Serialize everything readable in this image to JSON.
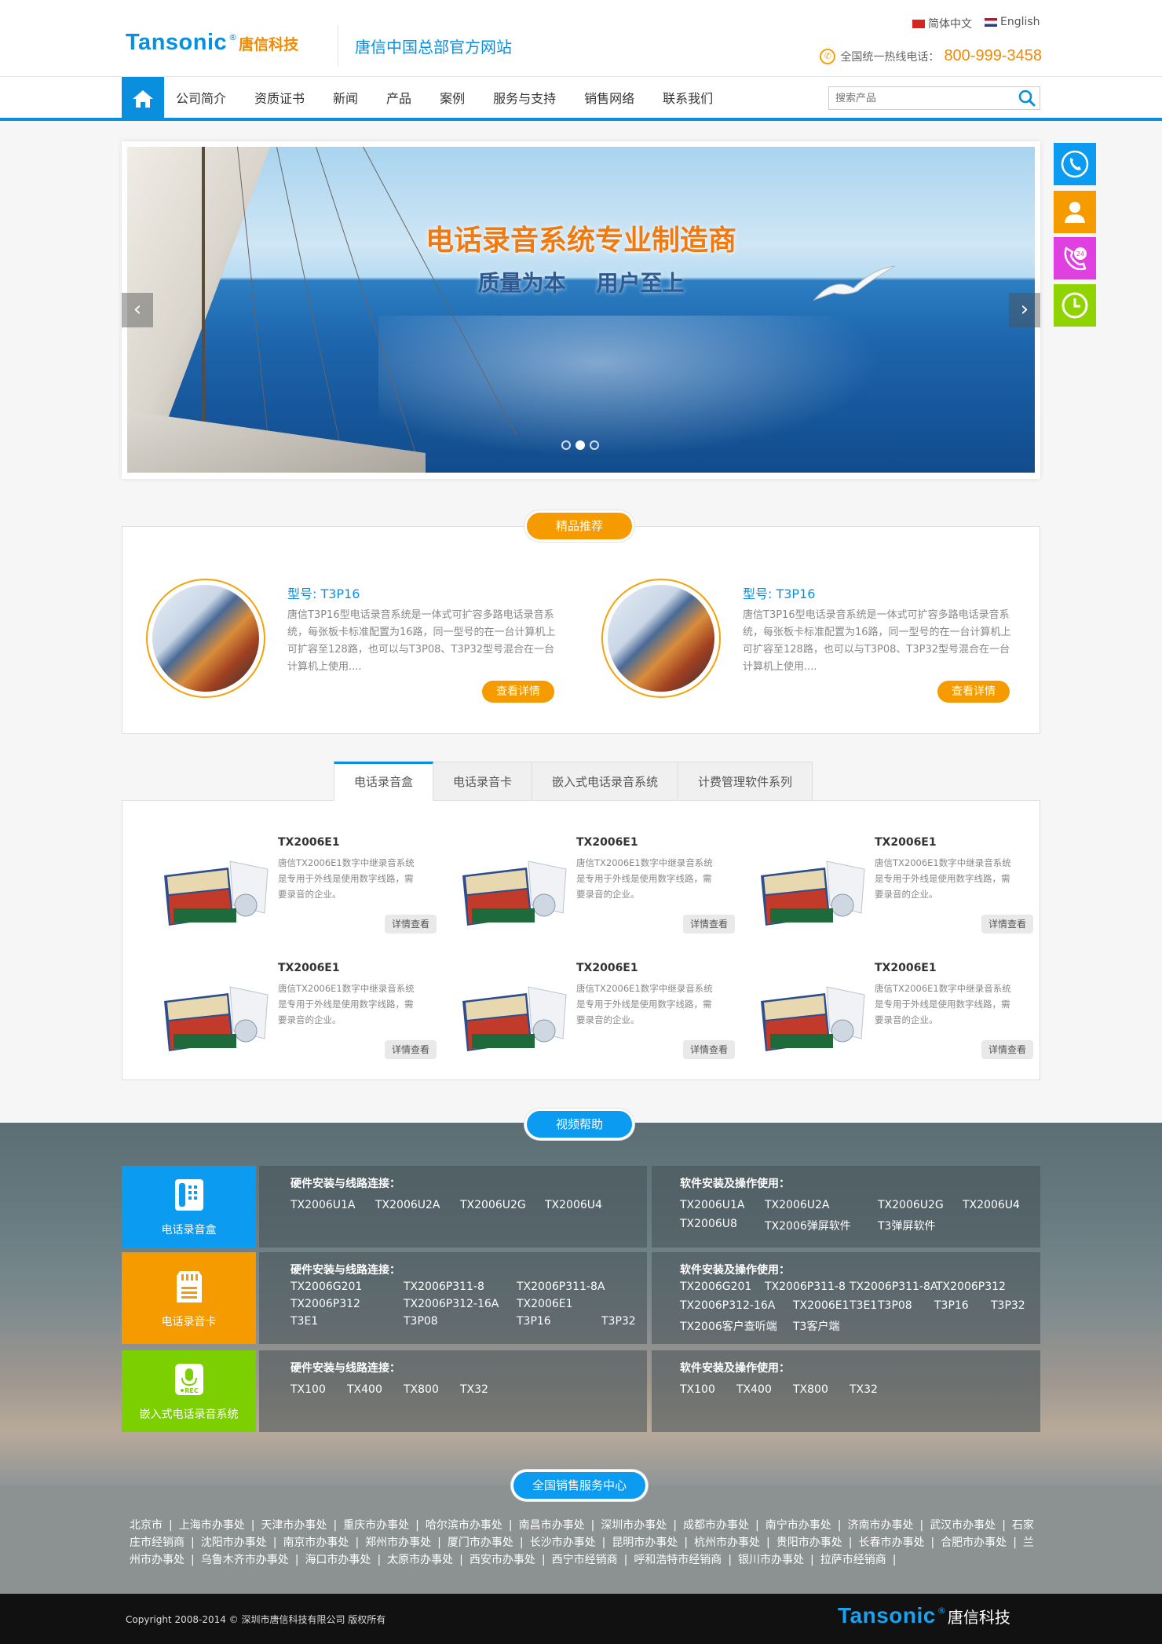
{
  "brand": {
    "name_en": "Tansonic",
    "reg": "®",
    "name_cn": "唐信科技",
    "site_title": "唐信中国总部官方网站"
  },
  "lang": {
    "cn": "简体中文",
    "en": "English"
  },
  "hotline": {
    "label": "全国统一热线电话：",
    "number": "800-999-3458"
  },
  "nav": {
    "home_icon": "home-icon",
    "items": [
      "公司简介",
      "资质证书",
      "新闻",
      "产品",
      "案例",
      "服务与支持",
      "销售网络",
      "联系我们"
    ],
    "search_placeholder": "搜索产品"
  },
  "banner": {
    "headline": "电话录音系统专业制造商",
    "subline": "质量为本    用户至上",
    "prev": "‹",
    "next": "›",
    "slides": 3,
    "active_slide": 2
  },
  "float_icons": [
    "phone-icon",
    "user-service-icon",
    "24h-phone-icon",
    "clock-icon"
  ],
  "featured": {
    "label": "精品推荐",
    "items": [
      {
        "model": "型号: T3P16",
        "desc": "唐信T3P16型电话录音系统是一体式可扩容多路电话录音系统，每张板卡标准配置为16路，同一型号的在一台计算机上可扩容至128路，也可以与T3P08、T3P32型号混合在一台计算机上使用....",
        "button": "查看详情"
      },
      {
        "model": "型号: T3P16",
        "desc": "唐信T3P16型电话录音系统是一体式可扩容多路电话录音系统，每张板卡标准配置为16路，同一型号的在一台计算机上可扩容至128路，也可以与T3P08、T3P32型号混合在一台计算机上使用....",
        "button": "查看详情"
      }
    ]
  },
  "tabs": [
    "电话录音盒",
    "电话录音卡",
    "嵌入式电话录音系统",
    "计费管理软件系列"
  ],
  "products": [
    {
      "title": "TX2006E1",
      "desc": "唐信TX2006E1数字中继录音系统是专用于外线是使用数字线路，需要录音的企业。",
      "button": "详情查看"
    },
    {
      "title": "TX2006E1",
      "desc": "唐信TX2006E1数字中继录音系统是专用于外线是使用数字线路，需要录音的企业。",
      "button": "详情查看"
    },
    {
      "title": "TX2006E1",
      "desc": "唐信TX2006E1数字中继录音系统是专用于外线是使用数字线路，需要录音的企业。",
      "button": "详情查看"
    },
    {
      "title": "TX2006E1",
      "desc": "唐信TX2006E1数字中继录音系统是专用于外线是使用数字线路，需要录音的企业。",
      "button": "详情查看"
    },
    {
      "title": "TX2006E1",
      "desc": "唐信TX2006E1数字中继录音系统是专用于外线是使用数字线路，需要录音的企业。",
      "button": "详情查看"
    },
    {
      "title": "TX2006E1",
      "desc": "唐信TX2006E1数字中继录音系统是专用于外线是使用数字线路，需要录音的企业。",
      "button": "详情查看"
    }
  ],
  "video": {
    "label": "视频帮助",
    "hw_title": "硬件安装与线路连接：",
    "sw_title": "软件安装及操作使用：",
    "rows": [
      {
        "category": "电话录音盒",
        "icon": "phone-box-icon",
        "color": "#0b9cf2",
        "hw": [
          "TX2006U1A",
          "TX2006U2A",
          "TX2006U2G",
          "TX2006U4"
        ],
        "sw": [
          "TX2006U1A",
          "TX2006U2A",
          "TX2006U2G",
          "TX2006U4",
          "TX2006U8",
          "TX2006弹屏软件",
          "T3弹屏软件"
        ]
      },
      {
        "category": "电话录音卡",
        "icon": "sd-card-icon",
        "color": "#f59b00",
        "hw": [
          "TX2006G201",
          "TX2006P311-8",
          "TX2006P311-8A",
          "TX2006P312",
          "TX2006P312-16A",
          "TX2006E1",
          "T3E1",
          "T3P08",
          "T3P16",
          "T3P32"
        ],
        "sw": [
          "TX2006G201",
          "TX2006P311-8",
          "TX2006P311-8A",
          "TX2006P312",
          "TX2006P312-16A",
          "TX2006E1",
          "T3E1",
          "T3P08",
          "T3P16",
          "T3P32",
          "TX2006客户查听端",
          "T3客户端"
        ]
      },
      {
        "category": "嵌入式电话录音系统",
        "icon": "rec-mic-icon",
        "color": "#7ccf00",
        "hw": [
          "TX100",
          "TX400",
          "TX800",
          "TX32"
        ],
        "sw": [
          "TX100",
          "TX400",
          "TX800",
          "TX32"
        ]
      }
    ]
  },
  "sales": {
    "label": "全国销售服务中心",
    "offices": [
      "北京市",
      "上海市办事处",
      "天津市办事处",
      "重庆市办事处",
      "哈尔滨市办事处",
      "南昌市办事处",
      "深圳市办事处",
      "成都市办事处",
      "南宁市办事处",
      "济南市办事处",
      "武汉市办事处",
      "石家庄市经销商",
      "沈阳市办事处",
      "南京市办事处",
      "郑州市办事处",
      "厦门市办事处",
      "长沙市办事处",
      "昆明市办事处",
      "杭州市办事处",
      "贵阳市办事处",
      "长春市办事处",
      "合肥市办事处",
      "兰州市办事处",
      "乌鲁木齐市办事处",
      "海口市办事处",
      "太原市办事处",
      "西安市办事处",
      "西宁市经销商",
      "呼和浩特市经销商",
      "银川市办事处",
      "拉萨市经销商"
    ]
  },
  "footer": {
    "copyright": "Copyright 2008-2014 © 深圳市唐信科技有限公司 版权所有"
  },
  "colors": {
    "brand_blue": "#0a8fde",
    "brand_orange": "#f08a00",
    "button_orange": "#f59b00",
    "card_green": "#7ccf00"
  }
}
